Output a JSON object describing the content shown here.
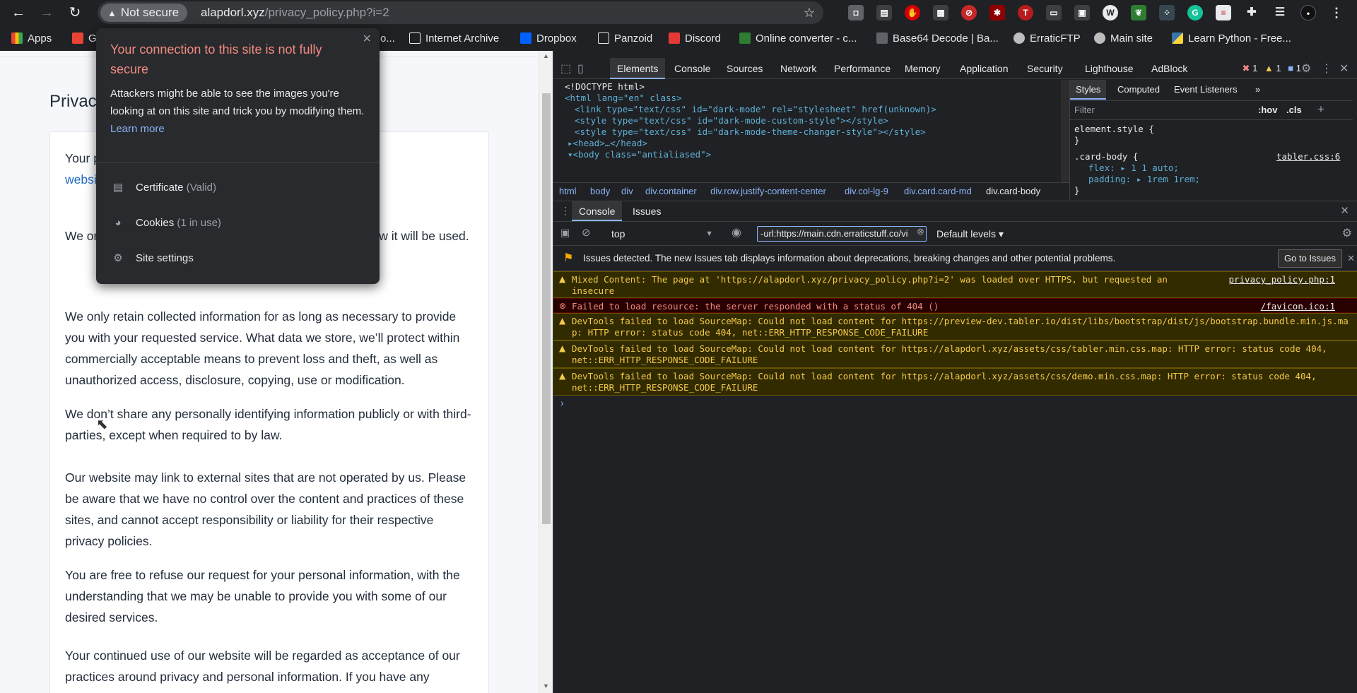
{
  "browser": {
    "secure_chip": "Not secure",
    "url_host": "alapdorl.xyz",
    "url_path": "/privacy_policy.php?i=2"
  },
  "bookmarks": [
    {
      "label": "Apps",
      "color": "#ea4335"
    },
    {
      "label": "G",
      "color": "#ea4335"
    },
    {
      "label": "o...",
      "color": "#5f6368"
    },
    {
      "label": "Internet Archive",
      "color": "#e8eaed"
    },
    {
      "label": "Dropbox",
      "color": "#0061ff"
    },
    {
      "label": "Panzoid",
      "color": "#e8eaed"
    },
    {
      "label": "Discord",
      "color": "#e53935"
    },
    {
      "label": "Online converter - c...",
      "color": "#2e7d32"
    },
    {
      "label": "Base64 Decode | Ba...",
      "color": "#e8eaed"
    },
    {
      "label": "ErraticFTP",
      "color": "#bdbdbd"
    },
    {
      "label": "Main site",
      "color": "#bdbdbd"
    },
    {
      "label": "Learn Python - Free...",
      "color": "#ffd43b"
    }
  ],
  "popup": {
    "title": "Your connection to this site is not fully secure",
    "body": "Attackers might be able to see the images you're looking at on this site and trick you by modifying them.",
    "learn_more": "Learn more",
    "rows": [
      {
        "label": "Certificate",
        "detail": "(Valid)",
        "icon": "certificate-icon"
      },
      {
        "label": "Cookies",
        "detail": "(1 in use)",
        "icon": "cookie-icon"
      },
      {
        "label": "Site settings",
        "detail": "",
        "icon": "gear-icon"
      }
    ]
  },
  "page": {
    "title": "Privac",
    "paragraphs": [
      {
        "text": "Your p                                                    spect your privac                                                    u across our",
        "link": "websi"
      },
      {
        "text": "We on                                                    it to provide a servic                                                    your knowledge and c                                                    and how it will be used."
      },
      {
        "text": "We only retain collected information for as long as necessary to provide you with your requested service. What data we store, we’ll protect within commercially acceptable means to prevent loss and theft, as well as unauthorized access, disclosure, copying, use or modification."
      },
      {
        "text": "We don’t share any personally identifying information publicly or with third-parties, except when required to by law."
      },
      {
        "text": "Our website may link to external sites that are not operated by us. Please be aware that we have no control over the content and practices of these sites, and cannot accept responsibility or liability for their respective privacy policies."
      },
      {
        "text": "You are free to refuse our request for your personal information, with the understanding that we may be unable to provide you with some of our desired services."
      },
      {
        "text": "Your continued use of our website will be regarded as acceptance of our practices around privacy and personal information. If you have any"
      }
    ]
  },
  "devtools": {
    "tabs": [
      "Elements",
      "Console",
      "Sources",
      "Network",
      "Performance",
      "Memory",
      "Application",
      "Security",
      "Lighthouse",
      "AdBlock"
    ],
    "counters": {
      "errors": "1",
      "warnings": "1",
      "info": "1"
    },
    "elements": [
      {
        "a": "<!DOCTYPE html>"
      },
      {
        "a": "<html lang=\"en\" class>"
      },
      {
        "a": "<link type=\"text/css\" id=\"dark-mode\" rel=\"stylesheet\" href(unknown)>"
      },
      {
        "a": "<style type=\"text/css\" id=\"dark-mode-custom-style\"></style>"
      },
      {
        "a": "<style type=\"text/css\" id=\"dark-mode-theme-changer-style\"></style>"
      },
      {
        "a": "▸<head>…</head>"
      },
      {
        "a": "▾<body class=\"antialiased\">"
      }
    ],
    "breadcrumbs": [
      "html",
      "body",
      "div",
      "div.container",
      "div.row.justify-content-center",
      "div.col-lg-9",
      "div.card.card-md",
      "div.card-body"
    ],
    "styles_tabs": [
      "Styles",
      "Computed",
      "Event Listeners",
      "»"
    ],
    "styles_filter": "Filter",
    "styles_hov": ":hov",
    "styles_cls": ".cls",
    "styles_lines": [
      "element.style {",
      "}",
      ".card-body {",
      "flex: ▸ 1 1 auto;",
      "padding: ▸ 1rem 1rem;",
      "}"
    ],
    "styles_source": "tabler.css:6",
    "drawer_tabs": [
      "Console",
      "Issues"
    ],
    "context": "top",
    "filter_value": "-url:https://main.cdn.erraticstuff.co/vi",
    "levels": "Default levels ▾",
    "issues_banner": "Issues detected. The new Issues tab displays information about deprecations, breaking changes and other potential problems.",
    "goto_issues": "Go to Issues",
    "messages": [
      {
        "level": "warning",
        "text": "Mixed Content: The page at 'https://alapdorl.xyz/privacy_policy.php?i=2' was loaded over HTTPS, but requested an insecure\nimage 'http://alapdorl.epizy.com/public/assets/img/user.png'. This content should also be served over HTTPS.",
        "source": "privacy_policy.php:1"
      },
      {
        "level": "error",
        "text": "Failed to load resource: the server responded with a status of 404 ()",
        "source": "/favicon.ico:1"
      },
      {
        "level": "warning",
        "text": "DevTools failed to load SourceMap: Could not load content for https://preview-dev.tabler.io/dist/libs/bootstrap/dist/js/bootstrap.bundle.min.js.ma\np: HTTP error: status code 404, net::ERR_HTTP_RESPONSE_CODE_FAILURE",
        "source": ""
      },
      {
        "level": "warning",
        "text": "DevTools failed to load SourceMap: Could not load content for https://alapdorl.xyz/assets/css/tabler.min.css.map: HTTP error: status code 404,\nnet::ERR_HTTP_RESPONSE_CODE_FAILURE",
        "source": ""
      },
      {
        "level": "warning",
        "text": "DevTools failed to load SourceMap: Could not load content for https://alapdorl.xyz/assets/css/demo.min.css.map: HTTP error: status code 404,\nnet::ERR_HTTP_RESPONSE_CODE_FAILURE",
        "source": ""
      }
    ],
    "prompt": "›"
  }
}
